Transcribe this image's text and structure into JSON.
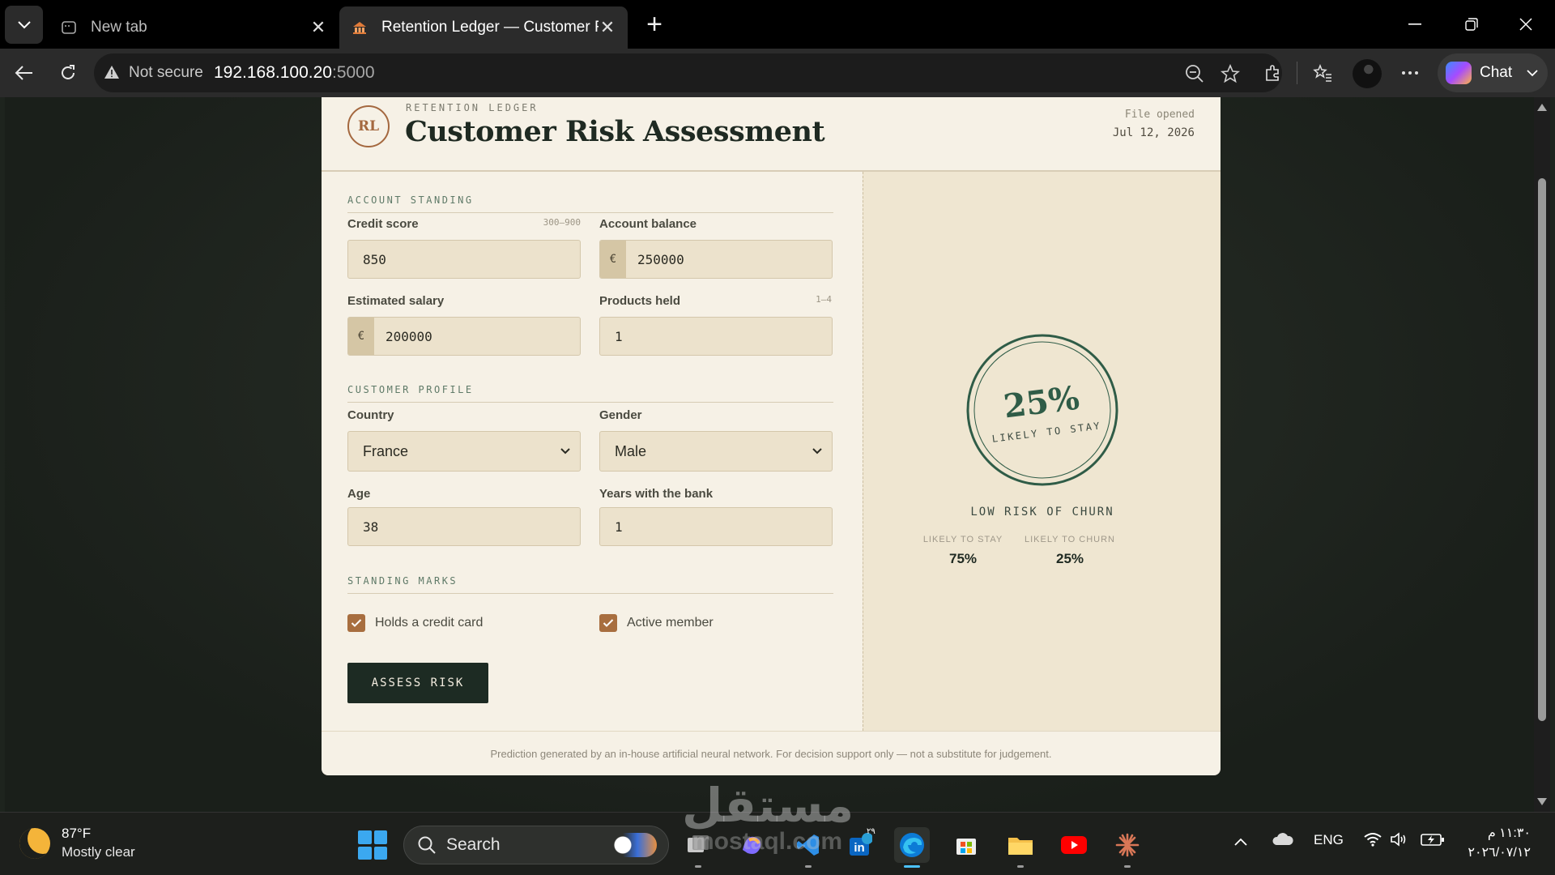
{
  "browser": {
    "tabs": [
      {
        "title": "New tab",
        "active": false
      },
      {
        "title": "Retention Ledger — Customer Risk Assessment",
        "active": true
      }
    ],
    "address": {
      "security_label": "Not secure",
      "host": "192.168.100.20",
      "port": ":5000"
    },
    "chat_label": "Chat"
  },
  "app": {
    "eyebrow": "RETENTION LEDGER",
    "seal": "RL",
    "title": "Customer Risk Assessment",
    "file_label": "File opened",
    "file_date": "Jul 12, 2026",
    "sections": {
      "account": "ACCOUNT STANDING",
      "profile": "CUSTOMER PROFILE",
      "marks": "STANDING MARKS"
    },
    "fields": {
      "credit_score": {
        "label": "Credit score",
        "hint": "300–900",
        "value": "850"
      },
      "balance": {
        "label": "Account balance",
        "prefix": "€",
        "value": "250000"
      },
      "salary": {
        "label": "Estimated salary",
        "prefix": "€",
        "value": "200000"
      },
      "products": {
        "label": "Products held",
        "hint": "1–4",
        "value": "1"
      },
      "country": {
        "label": "Country",
        "value": "France"
      },
      "gender": {
        "label": "Gender",
        "value": "Male"
      },
      "age": {
        "label": "Age",
        "value": "38"
      },
      "tenure": {
        "label": "Years with the bank",
        "value": "1"
      }
    },
    "checks": {
      "credit_card": {
        "label": "Holds a credit card",
        "checked": true
      },
      "active_member": {
        "label": "Active member",
        "checked": true
      }
    },
    "assess_button": "ASSESS RISK",
    "result": {
      "gauge_percent": "25%",
      "gauge_caption": "LIKELY TO STAY",
      "verdict": "LOW RISK OF CHURN",
      "stay_label": "LIKELY TO STAY",
      "stay_value": "75%",
      "churn_label": "LIKELY TO CHURN",
      "churn_value": "25%"
    },
    "footer": "Prediction generated by an in-house artificial neural network. For decision support only — not a substitute for judgement."
  },
  "taskbar": {
    "temperature": "87°F",
    "condition": "Mostly clear",
    "search_placeholder": "Search",
    "language": "ENG",
    "time": "١١:٣٠ م",
    "date": "٢٠٢٦/٠٧/١٢",
    "badge": "٢٩"
  },
  "watermark": {
    "arabic": "مستقل",
    "latin": "mostaql.com"
  },
  "colors": {
    "accent": "#a86e3f",
    "ink": "#1d2b23",
    "gauge": "#2f5c47",
    "paper": "#f6f1e6"
  }
}
